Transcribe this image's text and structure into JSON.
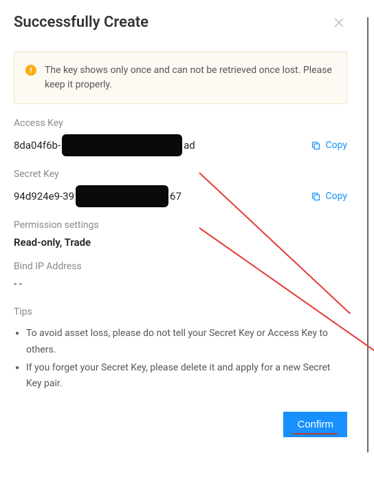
{
  "header": {
    "title": "Successfully Create"
  },
  "alert": {
    "text": "The key shows only once and can not be retrieved once lost. Please keep it properly."
  },
  "fields": {
    "access_key": {
      "label": "Access Key",
      "prefix": "8da04f6b-",
      "suffix": "ad",
      "copy": "Copy"
    },
    "secret_key": {
      "label": "Secret Key",
      "prefix": "94d924e9-39",
      "suffix": "67",
      "copy": "Copy"
    },
    "permission": {
      "label": "Permission settings",
      "value": "Read-only, Trade"
    },
    "bind_ip": {
      "label": "Bind IP Address",
      "value": "- -"
    }
  },
  "tips": {
    "label": "Tips",
    "items": [
      "To avoid asset loss, please do not tell your Secret Key or Access Key to others.",
      "If you forget your Secret Key, please delete it and apply for a new Secret Key pair."
    ]
  },
  "footer": {
    "confirm": "Confirm"
  }
}
